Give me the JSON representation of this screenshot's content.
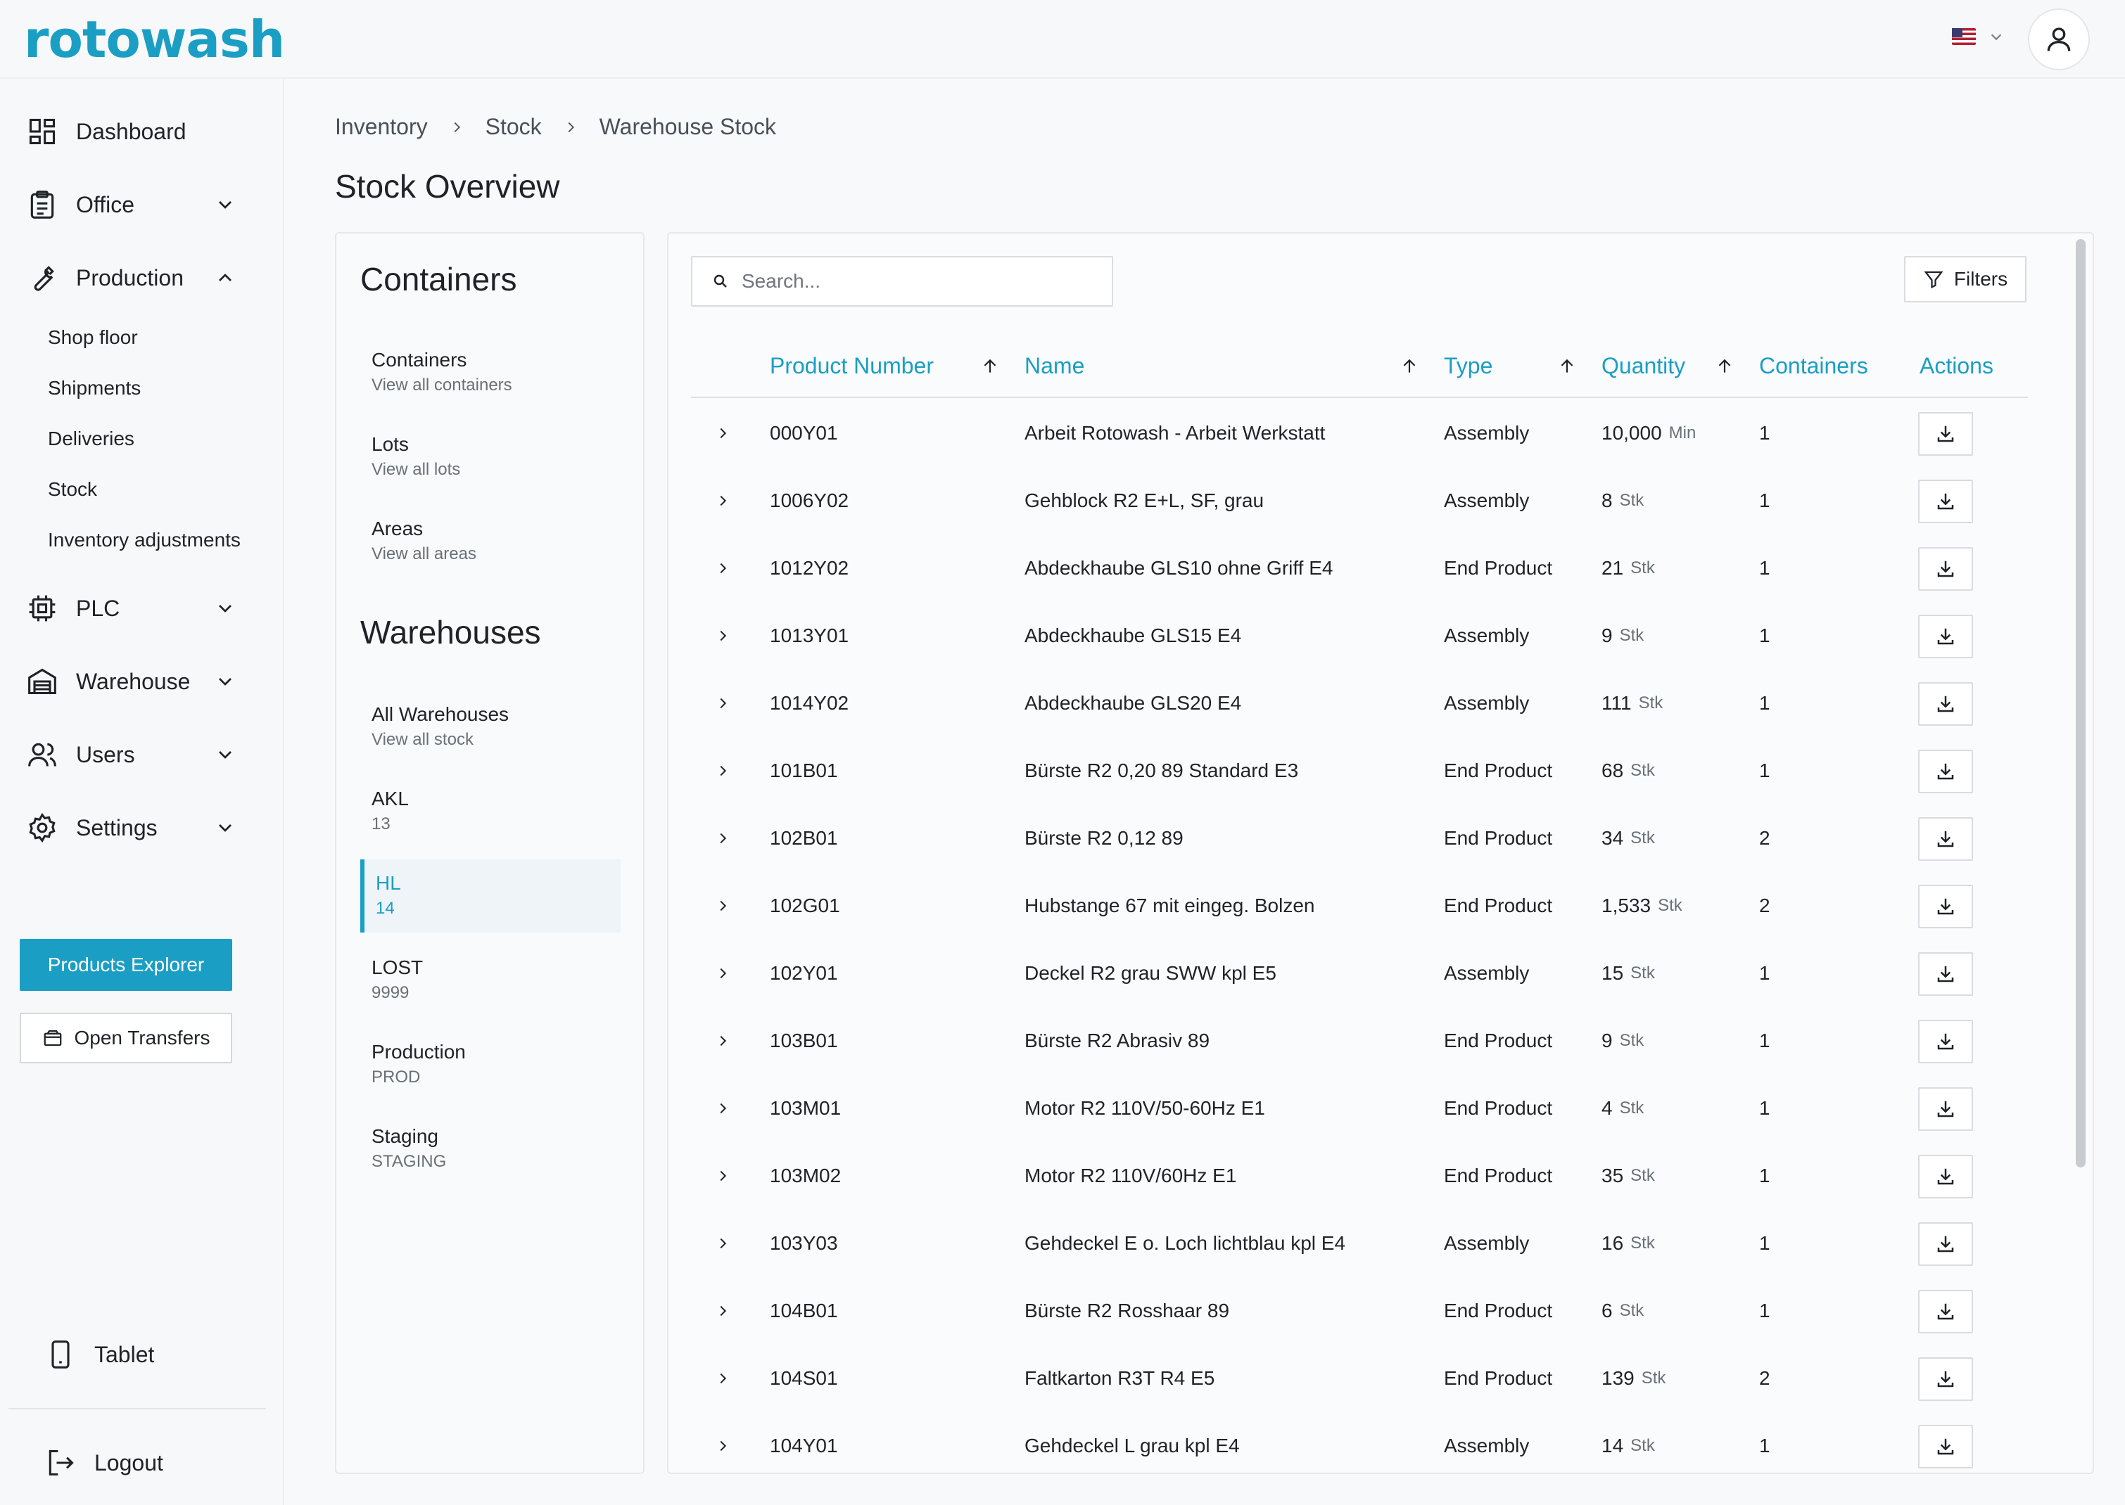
{
  "app": {
    "logo_text": "rotowash",
    "brand_color": "#1b9ec4"
  },
  "header": {
    "language_flag": "us-flag-icon",
    "user_icon": "user-icon"
  },
  "sidebar": {
    "nav": [
      {
        "label": "Dashboard",
        "icon": "dashboard-icon"
      },
      {
        "label": "Office",
        "icon": "clipboard-icon",
        "expanded": false
      },
      {
        "label": "Production",
        "icon": "wrench-icon",
        "expanded": true,
        "children": [
          "Shop floor",
          "Shipments",
          "Deliveries",
          "Stock",
          "Inventory adjustments"
        ]
      },
      {
        "label": "PLC",
        "icon": "chip-icon",
        "expanded": false
      },
      {
        "label": "Warehouse",
        "icon": "warehouse-icon",
        "expanded": false
      },
      {
        "label": "Users",
        "icon": "users-icon",
        "expanded": false
      },
      {
        "label": "Settings",
        "icon": "gear-icon",
        "expanded": false
      }
    ],
    "products_explorer_label": "Products Explorer",
    "open_transfers_label": "Open Transfers",
    "tablet_label": "Tablet",
    "logout_label": "Logout"
  },
  "breadcrumb": [
    "Inventory",
    "Stock",
    "Warehouse Stock"
  ],
  "page_title": "Stock Overview",
  "left_panel": {
    "containers_heading": "Containers",
    "containers_items": [
      {
        "title": "Containers",
        "subtitle": "View all containers"
      },
      {
        "title": "Lots",
        "subtitle": "View all lots"
      },
      {
        "title": "Areas",
        "subtitle": "View all areas"
      }
    ],
    "warehouses_heading": "Warehouses",
    "warehouse_items": [
      {
        "title": "All Warehouses",
        "subtitle": "View all stock"
      },
      {
        "title": "AKL",
        "subtitle": "13"
      },
      {
        "title": "HL",
        "subtitle": "14",
        "active": true
      },
      {
        "title": "LOST",
        "subtitle": "9999"
      },
      {
        "title": "Production",
        "subtitle": "PROD"
      },
      {
        "title": "Staging",
        "subtitle": "STAGING"
      }
    ]
  },
  "table": {
    "search_placeholder": "Search...",
    "filters_label": "Filters",
    "columns": [
      "Product Number",
      "Name",
      "Type",
      "Quantity",
      "Containers",
      "Actions"
    ],
    "rows": [
      {
        "number": "000Y01",
        "name": "Arbeit Rotowash - Arbeit Werkstatt",
        "type": "Assembly",
        "qty": "10,000",
        "unit": "Min",
        "containers": "1"
      },
      {
        "number": "1006Y02",
        "name": "Gehblock R2 E+L, SF, grau",
        "type": "Assembly",
        "qty": "8",
        "unit": "Stk",
        "containers": "1"
      },
      {
        "number": "1012Y02",
        "name": "Abdeckhaube GLS10 ohne Griff E4",
        "type": "End Product",
        "qty": "21",
        "unit": "Stk",
        "containers": "1"
      },
      {
        "number": "1013Y01",
        "name": "Abdeckhaube GLS15 E4",
        "type": "Assembly",
        "qty": "9",
        "unit": "Stk",
        "containers": "1"
      },
      {
        "number": "1014Y02",
        "name": "Abdeckhaube GLS20 E4",
        "type": "Assembly",
        "qty": "111",
        "unit": "Stk",
        "containers": "1"
      },
      {
        "number": "101B01",
        "name": "Bürste R2 0,20 89 Standard E3",
        "type": "End Product",
        "qty": "68",
        "unit": "Stk",
        "containers": "1"
      },
      {
        "number": "102B01",
        "name": "Bürste R2 0,12 89",
        "type": "End Product",
        "qty": "34",
        "unit": "Stk",
        "containers": "2"
      },
      {
        "number": "102G01",
        "name": "Hubstange 67 mit eingeg. Bolzen",
        "type": "End Product",
        "qty": "1,533",
        "unit": "Stk",
        "containers": "2"
      },
      {
        "number": "102Y01",
        "name": "Deckel R2 grau SWW kpl E5",
        "type": "Assembly",
        "qty": "15",
        "unit": "Stk",
        "containers": "1"
      },
      {
        "number": "103B01",
        "name": "Bürste R2 Abrasiv 89",
        "type": "End Product",
        "qty": "9",
        "unit": "Stk",
        "containers": "1"
      },
      {
        "number": "103M01",
        "name": "Motor R2 110V/50-60Hz E1",
        "type": "End Product",
        "qty": "4",
        "unit": "Stk",
        "containers": "1"
      },
      {
        "number": "103M02",
        "name": "Motor R2 110V/60Hz E1",
        "type": "End Product",
        "qty": "35",
        "unit": "Stk",
        "containers": "1"
      },
      {
        "number": "103Y03",
        "name": "Gehdeckel E o. Loch lichtblau kpl E4",
        "type": "Assembly",
        "qty": "16",
        "unit": "Stk",
        "containers": "1"
      },
      {
        "number": "104B01",
        "name": "Bürste R2 Rosshaar 89",
        "type": "End Product",
        "qty": "6",
        "unit": "Stk",
        "containers": "1"
      },
      {
        "number": "104S01",
        "name": "Faltkarton R3T R4 E5",
        "type": "End Product",
        "qty": "139",
        "unit": "Stk",
        "containers": "2"
      },
      {
        "number": "104Y01",
        "name": "Gehdeckel L grau kpl E4",
        "type": "Assembly",
        "qty": "14",
        "unit": "Stk",
        "containers": "1"
      }
    ]
  }
}
